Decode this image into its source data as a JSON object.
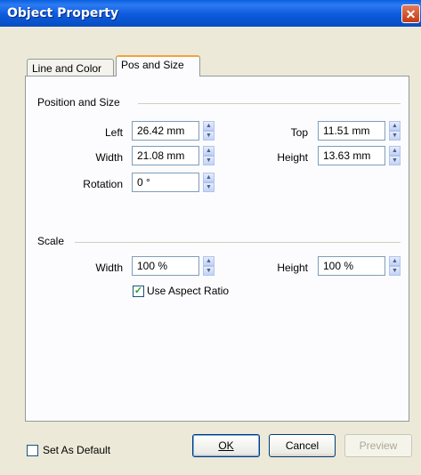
{
  "window": {
    "title": "Object Property"
  },
  "tabs": [
    {
      "label": "Line and Color",
      "active": false
    },
    {
      "label": "Pos and Size",
      "active": true
    }
  ],
  "position_group": {
    "title": "Position and Size",
    "left": {
      "label": "Left",
      "value": "26.42 mm"
    },
    "top": {
      "label": "Top",
      "value": "11.51 mm"
    },
    "width": {
      "label": "Width",
      "value": "21.08 mm"
    },
    "height": {
      "label": "Height",
      "value": "13.63 mm"
    },
    "rotation": {
      "label": "Rotation",
      "value": "0 °"
    }
  },
  "scale_group": {
    "title": "Scale",
    "width": {
      "label": "Width",
      "value": "100 %"
    },
    "height": {
      "label": "Height",
      "value": "100 %"
    },
    "aspect": {
      "label": "Use Aspect Ratio",
      "checked": true
    }
  },
  "footer": {
    "set_default": {
      "label": "Set As Default",
      "checked": false
    },
    "ok_label": "OK",
    "cancel_label": "Cancel",
    "preview_label": "Preview"
  },
  "colors": {
    "titlebar": "#0A5FE0",
    "dialog_bg": "#ECE9D8",
    "panel_bg": "#FCFCFE",
    "tab_accent": "#F2A536"
  }
}
